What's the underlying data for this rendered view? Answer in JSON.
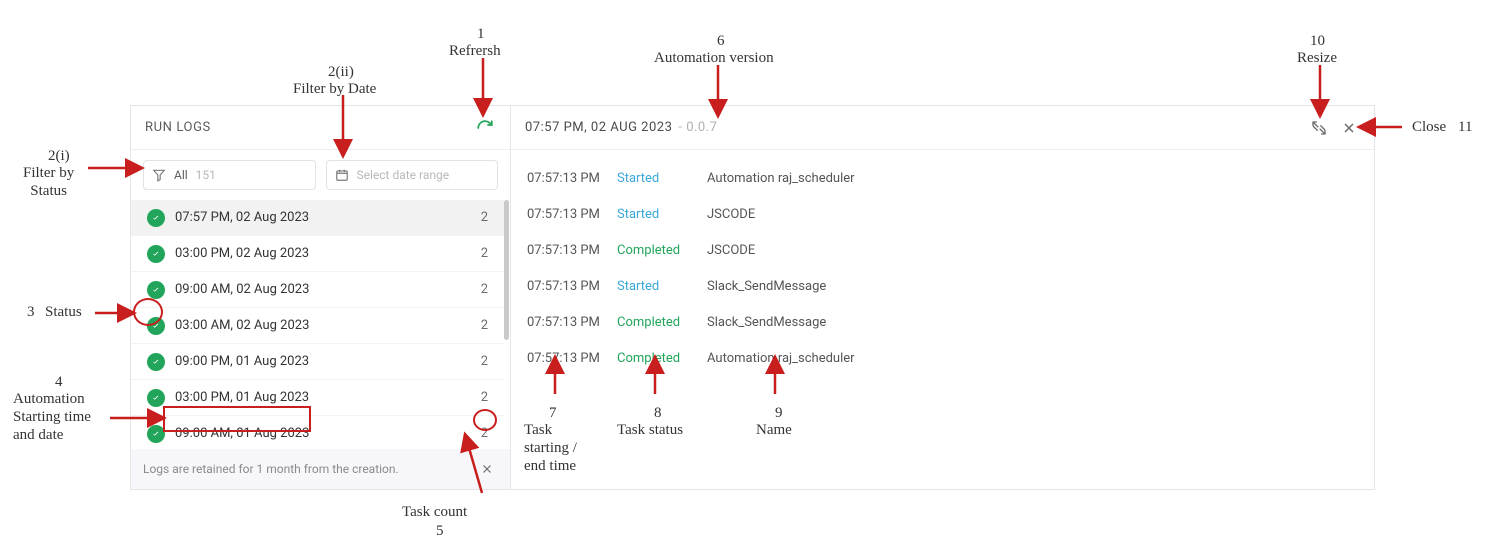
{
  "left": {
    "title": "RUN LOGS",
    "filter_status": {
      "label": "All",
      "count": "151"
    },
    "filter_date_placeholder": "Select date range",
    "retention": "Logs are retained for 1 month from the creation.",
    "rows": [
      {
        "time": "07:57 PM, 02 Aug 2023",
        "count": "2",
        "selected": true
      },
      {
        "time": "03:00 PM, 02 Aug 2023",
        "count": "2"
      },
      {
        "time": "09:00 AM, 02 Aug 2023",
        "count": "2"
      },
      {
        "time": "03:00 AM, 02 Aug 2023",
        "count": "2"
      },
      {
        "time": "09:00 PM, 01 Aug 2023",
        "count": "2"
      },
      {
        "time": "03:00 PM, 01 Aug 2023",
        "count": "2"
      },
      {
        "time": "09:00 AM, 01 Aug 2023",
        "count": "2"
      }
    ]
  },
  "right": {
    "title": "07:57 PM, 02 AUG 2023",
    "version": "- 0.0.7",
    "rows": [
      {
        "time": "07:57:13 PM",
        "status": "Started",
        "name": "Automation raj_scheduler"
      },
      {
        "time": "07:57:13 PM",
        "status": "Started",
        "name": "JSCODE"
      },
      {
        "time": "07:57:13 PM",
        "status": "Completed",
        "name": "JSCODE"
      },
      {
        "time": "07:57:13 PM",
        "status": "Started",
        "name": "Slack_SendMessage"
      },
      {
        "time": "07:57:13 PM",
        "status": "Completed",
        "name": "Slack_SendMessage"
      },
      {
        "time": "07:57:13 PM",
        "status": "Completed",
        "name": "Automation raj_scheduler"
      }
    ]
  },
  "annotations": {
    "a1": {
      "num": "1",
      "text": "Refrersh"
    },
    "a2i": {
      "num": "2(i)",
      "text": "Filter by\nStatus"
    },
    "a2ii": {
      "num": "2(ii)",
      "text": "Filter by Date"
    },
    "a3": {
      "num": "3",
      "text": "Status"
    },
    "a4": {
      "num": "4",
      "text": "Automation\nStarting time\nand date"
    },
    "a5": {
      "num": "5",
      "text": "Task count"
    },
    "a6": {
      "num": "6",
      "text": "Automation version"
    },
    "a7": {
      "num": "7",
      "text": "Task\nstarting /\nend time"
    },
    "a8": {
      "num": "8",
      "text": "Task status"
    },
    "a9": {
      "num": "9",
      "text": "Name"
    },
    "a10": {
      "num": "10",
      "text": "Resize"
    },
    "a11": {
      "num": "11",
      "text": "Close"
    }
  }
}
